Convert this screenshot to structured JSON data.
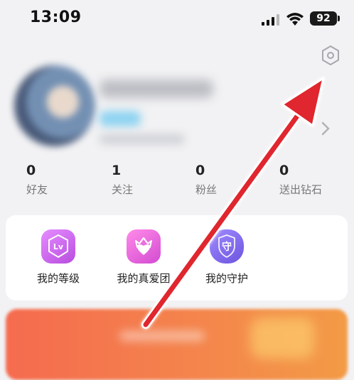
{
  "status_bar": {
    "time": "13:09",
    "battery": "92",
    "icons": [
      "cellular-signal-icon",
      "wifi-icon",
      "battery-icon"
    ]
  },
  "header": {
    "settings_icon": "settings-hex-icon"
  },
  "profile": {
    "chevron_icon": "chevron-right-icon"
  },
  "stats": [
    {
      "value": "0",
      "label": "好友"
    },
    {
      "value": "1",
      "label": "关注"
    },
    {
      "value": "0",
      "label": "粉丝"
    },
    {
      "value": "0",
      "label": "送出钻石"
    }
  ],
  "features": [
    {
      "label": "我的等级",
      "icon": "lv-badge-icon",
      "color": "#c85be8"
    },
    {
      "label": "我的真爱团",
      "icon": "heart-crown-icon",
      "color": "#df58d8"
    },
    {
      "label": "我的守护",
      "icon": "guard-shield-icon",
      "color": "#7f5ce4"
    }
  ],
  "feature_icon_glyphs": {
    "level": "Lv",
    "guard": "守"
  },
  "colors": {
    "arrow": "#e0262d",
    "banner_start": "#f56b4f",
    "banner_end": "#f39b46",
    "background": "#f2f2f4"
  }
}
